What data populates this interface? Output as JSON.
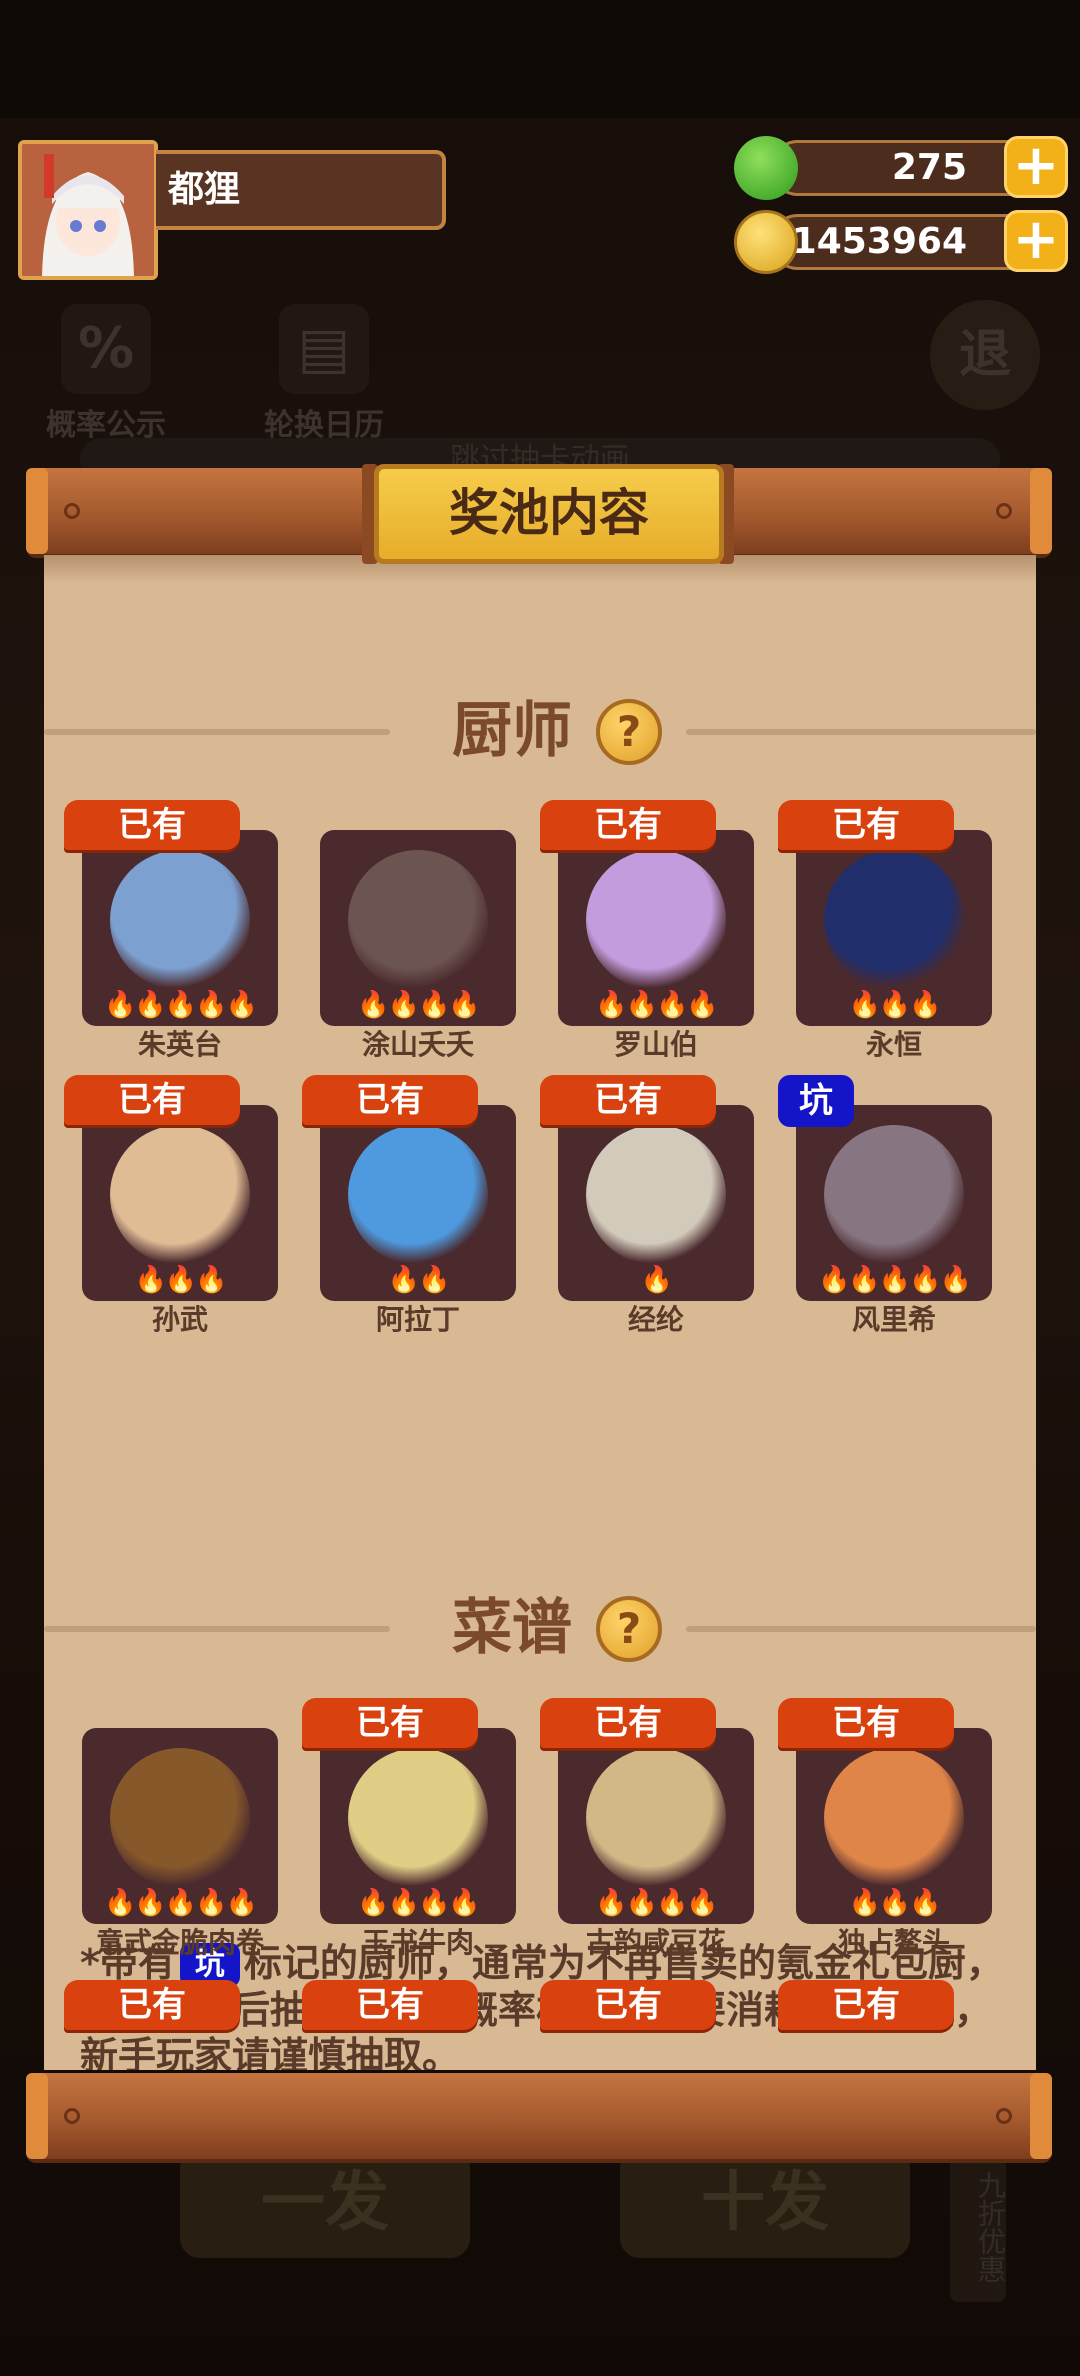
{
  "background": {
    "probability_label": "概率公示",
    "rotation_label": "轮换日历",
    "exit_label": "退",
    "banner_text": "跳过抽卡动画",
    "draw_once_label": "一发",
    "draw_ten_label": "十发",
    "discount_label": "九折优惠"
  },
  "player": {
    "name": "都狸"
  },
  "resources": {
    "jade": {
      "value": "275",
      "icon": "green-jade-icon"
    },
    "coins": {
      "value": "1453964",
      "icon": "gold-coin-icon"
    },
    "add_symbol": "+"
  },
  "panel": {
    "title": "奖池内容",
    "help_symbol": "?",
    "owned_tag": "已有",
    "pit_tag": "坑",
    "chef_section": {
      "title": "厨师",
      "items": [
        {
          "name": "朱英台",
          "owned": true,
          "stars": "🔥🔥🔥🔥🔥",
          "color": "#7fa6d9"
        },
        {
          "name": "涂山夭夭",
          "owned": false,
          "stars": "🔥🔥🔥🔥",
          "color": "#6e5652"
        },
        {
          "name": "罗山伯",
          "owned": true,
          "stars": "🔥🔥🔥🔥",
          "color": "#c9a2e6"
        },
        {
          "name": "永恒",
          "owned": true,
          "stars": "🔥🔥🔥",
          "color": "#1e2e6e"
        },
        {
          "name": "孙武",
          "owned": true,
          "stars": "🔥🔥🔥",
          "color": "#e8c49a"
        },
        {
          "name": "阿拉丁",
          "owned": true,
          "stars": "🔥🔥",
          "color": "#4fa0e8"
        },
        {
          "name": "经纶",
          "owned": true,
          "stars": "🔥",
          "color": "#d9d2c2"
        },
        {
          "name": "风里希",
          "owned": false,
          "pit": true,
          "stars": "🔥🔥🔥🔥🔥",
          "color": "#8a7a86"
        }
      ],
      "note_prefix": "*带有",
      "note_suffix": "标记的厨师，通常为不再售卖的氪金礼包厨，进入奖池后抽取获得的概率极低，需要消耗大量玉璧，新手玩家请谨慎抽取。"
    },
    "recipe_section": {
      "title": "菜谱",
      "items": [
        {
          "name": "意式金脆肉卷",
          "owned": false,
          "stars": "🔥🔥🔥🔥🔥",
          "color": "#8a5a2a"
        },
        {
          "name": "玉书牛肉",
          "owned": true,
          "stars": "🔥🔥🔥🔥",
          "color": "#e8d68a"
        },
        {
          "name": "古韵咸豆花",
          "owned": true,
          "stars": "🔥🔥🔥🔥",
          "color": "#d9c08a"
        },
        {
          "name": "独占鳌头",
          "owned": true,
          "stars": "🔥🔥🔥",
          "color": "#e88a4a"
        }
      ],
      "next_row_tags": [
        "已有",
        "已有",
        "已有",
        "已有"
      ]
    }
  }
}
